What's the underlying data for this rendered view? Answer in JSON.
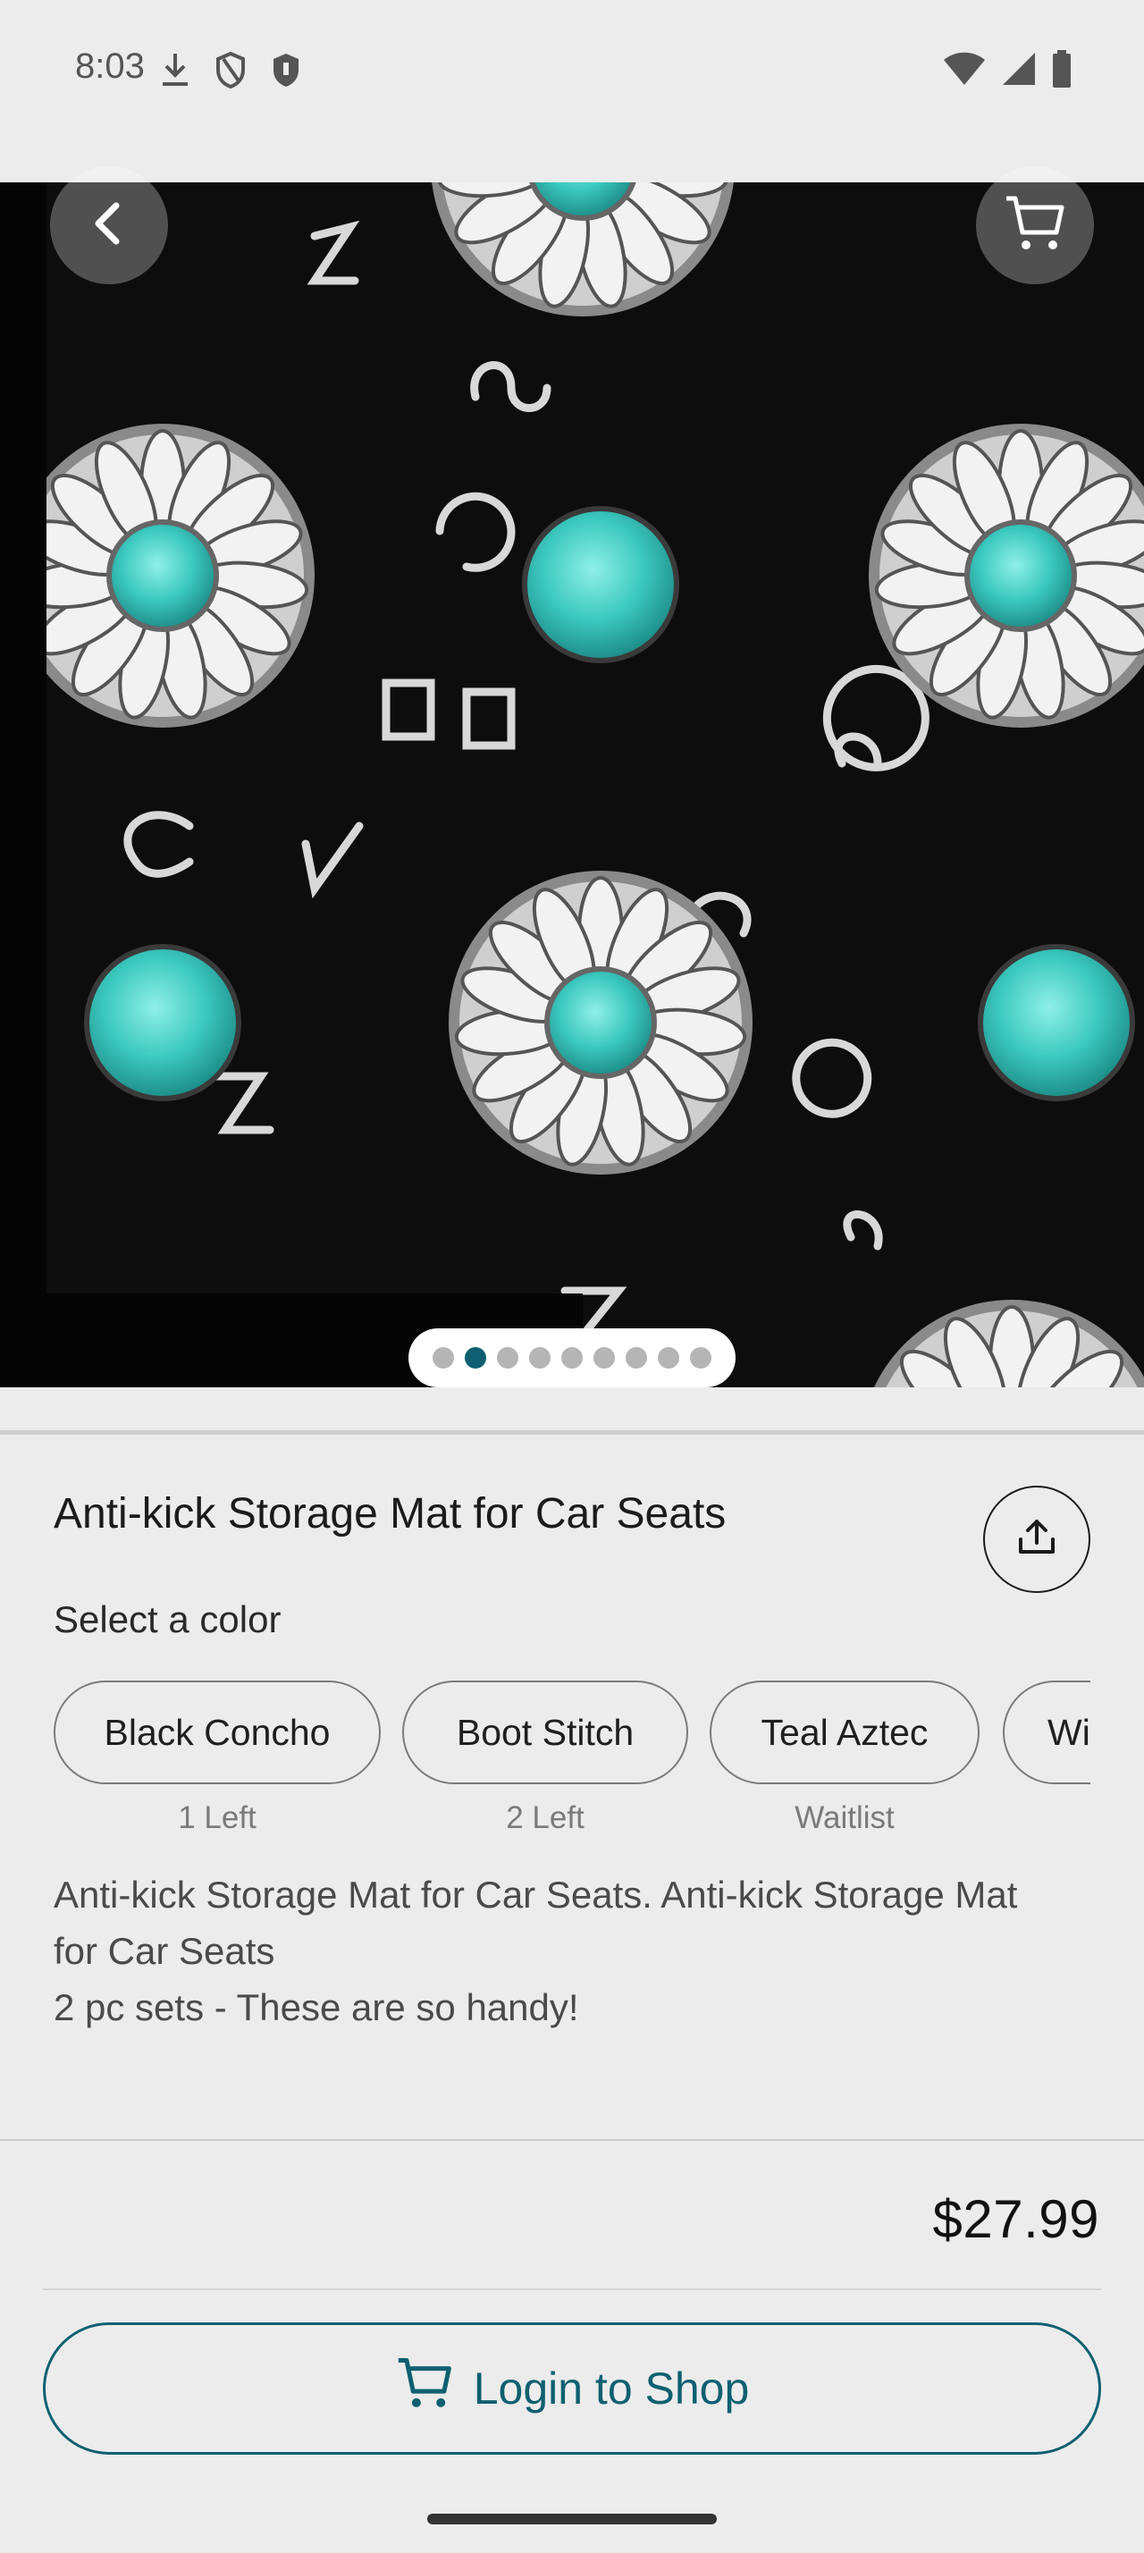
{
  "status_bar": {
    "time": "8:03",
    "icons_left": [
      "download-icon",
      "shield-outline-icon",
      "shield-filled-icon"
    ],
    "icons_right": [
      "wifi-icon",
      "cellular-icon",
      "battery-icon"
    ]
  },
  "hero": {
    "image": "product-photo-concho-pattern",
    "page_count": 9,
    "active_page": 2,
    "back_icon": "chevron-left-icon",
    "cart_icon": "cart-icon"
  },
  "product": {
    "title": "Anti-kick Storage Mat for Car Seats",
    "share_icon": "share-icon",
    "select_label": "Select a color",
    "colors": [
      {
        "label": "Black Concho",
        "note": "1 Left"
      },
      {
        "label": "Boot Stitch",
        "note": "2 Left"
      },
      {
        "label": "Teal Aztec",
        "note": "Waitlist"
      },
      {
        "label": "Wi",
        "note": ""
      }
    ],
    "description_lines": [
      "Anti-kick Storage Mat for Car Seats. Anti-kick Storage Mat",
      "for Car Seats",
      "2 pc sets - These are so handy!"
    ]
  },
  "footer": {
    "price": "$27.99",
    "cta_label": "Login to Shop",
    "cta_icon": "cart-icon"
  },
  "colors": {
    "accent": "#0e6070",
    "background": "#ececec",
    "turquoise": "#40c8c0"
  }
}
